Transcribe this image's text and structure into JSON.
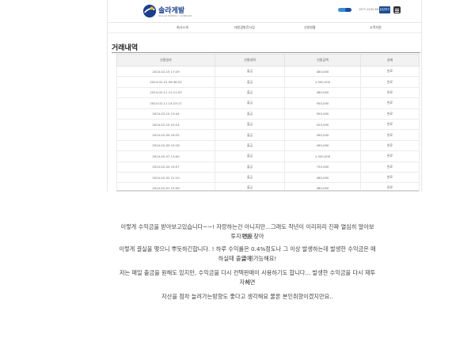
{
  "header": {
    "logo_text": "솔라게발",
    "logo_subtitle": "SOLAR ENERGY COMPANY",
    "phone": "1577-1234 5678",
    "consult_label": "상담하기"
  },
  "nav": [
    "회사소개",
    "태양광발전사업",
    "신청현황",
    "고객지원"
  ],
  "section_title": "거래내역",
  "table": {
    "columns": [
      "신청일자",
      "신청내역",
      "신청금액",
      "상태"
    ],
    "rows": [
      [
        "2024-02-15 17:29",
        "출금",
        "480,000",
        "완료"
      ],
      [
        "2024-02-15 09:46:25",
        "출금",
        "1,300,000",
        "완료"
      ],
      [
        "2024-02-11 21:11:53",
        "출금",
        "480,000",
        "완료"
      ],
      [
        "2024-02-11 14:23:17",
        "출금",
        "550,000",
        "완료"
      ],
      [
        "2024-02-10 13:44",
        "출금",
        "550,000",
        "완료"
      ],
      [
        "2024-02-10 10:24",
        "출금",
        "520,000",
        "완료"
      ],
      [
        "2024-02-09 18:25",
        "출금",
        "490,000",
        "완료"
      ],
      [
        "2024-02-09 15:16",
        "출금",
        "490,000",
        "완료"
      ],
      [
        "2024-02-07 13:00",
        "출금",
        "1,300,000",
        "완료"
      ],
      [
        "2024-02-04 19:07",
        "출금",
        "750,000",
        "완료"
      ],
      [
        "2024-02-02 21:10",
        "출금",
        "480,000",
        "완료"
      ],
      [
        "2024-02-01 15:49",
        "출금",
        "480,000",
        "완료"
      ],
      [
        "2024-01-31 01:00",
        "출금",
        "480,000",
        "완료"
      ]
    ]
  },
  "paragraphs": [
    "이렇게 수익금을 받아보고있습니다~~! 자랑하는건 아니지만...그래도 작년이 이리저리 진짜 열심히 알아보면서",
    "투자처를 찾아",
    "이렇게 결실을 맺으니 뿌듯하긴합니다. ! 하루 수익률은 0.4%정도나 그 이상 발생하는데 발생한 수익금은 매일 원",
    "하실때 출금이 가능해요!",
    "저는 매일 출금을 원해도 있지만, 수익금을 다시 컨텍판매이 사용하기도 합니다... 발생한 수익금을 다시 재투자하면",
    "서",
    "자산을 점차 늘려가는방향도 좋다고 생각해요 물론 본인취향이겠지만요.."
  ]
}
